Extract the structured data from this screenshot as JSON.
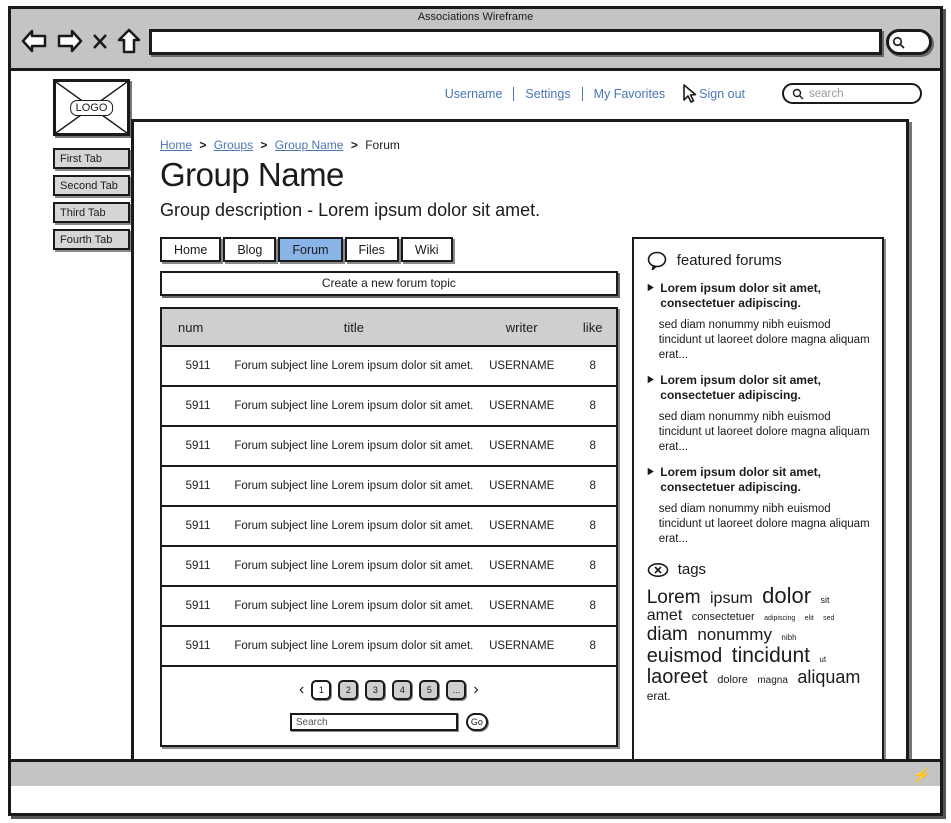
{
  "browser": {
    "window_title": "Associations Wireframe",
    "address_value": "",
    "icons": [
      "back-arrow-icon",
      "forward-arrow-icon",
      "stop-x-icon",
      "home-arrow-icon",
      "search-icon"
    ]
  },
  "sidebar_rail": {
    "logo_label": "LOGO",
    "tabs": [
      {
        "label": "First Tab"
      },
      {
        "label": "Second Tab"
      },
      {
        "label": "Third Tab"
      },
      {
        "label": "Fourth Tab"
      }
    ]
  },
  "user_nav": {
    "username": "Username",
    "settings": "Settings",
    "favorites": "My Favorites",
    "signout": "Sign out",
    "search_placeholder": "search"
  },
  "breadcrumb": {
    "home": "Home",
    "groups": "Groups",
    "group_name": "Group Name",
    "current": "Forum",
    "separator": ">"
  },
  "page": {
    "title": "Group Name",
    "description": "Group description - Lorem ipsum dolor sit amet."
  },
  "tabs": [
    {
      "label": "Home",
      "active": false
    },
    {
      "label": "Blog",
      "active": false
    },
    {
      "label": "Forum",
      "active": true
    },
    {
      "label": "Files",
      "active": false
    },
    {
      "label": "Wiki",
      "active": false
    }
  ],
  "create_button": "Create a new forum topic",
  "table": {
    "headers": {
      "num": "num",
      "title": "title",
      "writer": "writer",
      "like": "like"
    },
    "rows": [
      {
        "num": "5911",
        "title": "Forum subject line Lorem ipsum dolor sit amet.",
        "writer": "USERNAME",
        "like": "8"
      },
      {
        "num": "5911",
        "title": "Forum subject line Lorem ipsum dolor sit amet.",
        "writer": "USERNAME",
        "like": "8"
      },
      {
        "num": "5911",
        "title": "Forum subject line Lorem ipsum dolor sit amet.",
        "writer": "USERNAME",
        "like": "8"
      },
      {
        "num": "5911",
        "title": "Forum subject line Lorem ipsum dolor sit amet.",
        "writer": "USERNAME",
        "like": "8"
      },
      {
        "num": "5911",
        "title": "Forum subject line Lorem ipsum dolor sit amet.",
        "writer": "USERNAME",
        "like": "8"
      },
      {
        "num": "5911",
        "title": "Forum subject line Lorem ipsum dolor sit amet.",
        "writer": "USERNAME",
        "like": "8"
      },
      {
        "num": "5911",
        "title": "Forum subject line Lorem ipsum dolor sit amet.",
        "writer": "USERNAME",
        "like": "8"
      },
      {
        "num": "5911",
        "title": "Forum subject line Lorem ipsum dolor sit amet.",
        "writer": "USERNAME",
        "like": "8"
      }
    ]
  },
  "pagination": {
    "prev": "‹",
    "next": "›",
    "pages": [
      {
        "label": "1",
        "active": true
      },
      {
        "label": "2",
        "active": false
      },
      {
        "label": "3",
        "active": false
      },
      {
        "label": "4",
        "active": false
      },
      {
        "label": "5",
        "active": false
      },
      {
        "label": "...",
        "active": false
      }
    ]
  },
  "table_search": {
    "value": "Search",
    "go_label": "Go"
  },
  "featured": {
    "heading": "featured forums",
    "items": [
      {
        "title": "Lorem ipsum dolor sit amet, consectetuer adipiscing.",
        "body": "sed diam nonummy nibh euismod tincidunt ut laoreet dolore magna aliquam erat..."
      },
      {
        "title": "Lorem ipsum dolor sit amet, consectetuer adipiscing.",
        "body": "sed diam nonummy nibh euismod tincidunt ut laoreet dolore magna aliquam erat..."
      },
      {
        "title": "Lorem ipsum dolor sit amet, consectetuer adipiscing.",
        "body": "sed diam nonummy nibh euismod tincidunt ut laoreet dolore magna aliquam erat..."
      }
    ]
  },
  "tags": {
    "heading": "tags",
    "cloud": [
      {
        "label": "Lorem",
        "size": 19
      },
      {
        "label": "ipsum",
        "size": 16
      },
      {
        "label": "dolor",
        "size": 22
      },
      {
        "label": "sit",
        "size": 9
      },
      {
        "label": "amet",
        "size": 16
      },
      {
        "label": "consectetuer",
        "size": 11
      },
      {
        "label": "adipiscing",
        "size": 7
      },
      {
        "label": "elit",
        "size": 7
      },
      {
        "label": "sed",
        "size": 7
      },
      {
        "label": "diam",
        "size": 19
      },
      {
        "label": "nonummy",
        "size": 17
      },
      {
        "label": "nibh",
        "size": 8
      },
      {
        "label": "euismod",
        "size": 20
      },
      {
        "label": "tincidunt",
        "size": 21
      },
      {
        "label": "ut",
        "size": 8
      },
      {
        "label": "laoreet",
        "size": 20
      },
      {
        "label": "dolore",
        "size": 11
      },
      {
        "label": "magna",
        "size": 10
      },
      {
        "label": "aliquam",
        "size": 18
      },
      {
        "label": "erat.",
        "size": 12
      }
    ]
  },
  "colors": {
    "link_blue": "#4a77b4",
    "active_tab_blue": "#8ab4e8",
    "chrome_gray": "#c4c4c4",
    "header_gray": "#cfcfcf",
    "rail_tab_gray": "#d6d6d6",
    "ink": "#1a1a1a"
  }
}
